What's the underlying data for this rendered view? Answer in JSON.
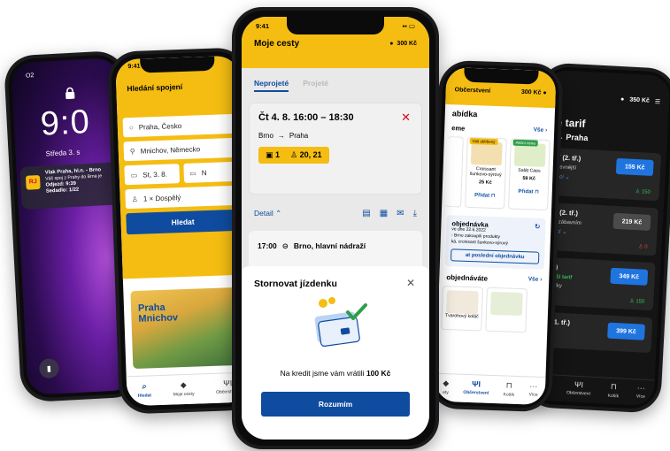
{
  "lock": {
    "carrier": "O2",
    "time": "9:0",
    "date": "Středa 3. s",
    "badge": "RJ",
    "notif_title": "Vlak Praha, hl.n. - Brno",
    "notif_line1": "Váš spoj z Prahy do Brna je",
    "notif_line2": "Odjezd: 9:39",
    "notif_line3": "Sedadlo: 1/22"
  },
  "search": {
    "time": "9:41",
    "title": "Hledání spojení",
    "from": "Praha, Česko",
    "to": "Mnichov, Německo",
    "date": "St, 3. 8.",
    "return": "N",
    "passengers": "1 × Dospělý",
    "button": "Hledat",
    "promo_line1": "Praha",
    "promo_line2": "Mnichov",
    "tabs": [
      "Hledat",
      "Moje cesty",
      "Občerstvení"
    ]
  },
  "trips": {
    "time": "9:41",
    "title": "Moje cesty",
    "credit": "300 Kč",
    "tab_active": "Neprojeté",
    "tab_inactive": "Projeté",
    "trip_when": "Čt 4. 8. 16:00 – 18:30",
    "trip_from": "Brno",
    "trip_to": "Praha",
    "car": "1",
    "seats": "20, 21",
    "detail": "Detail",
    "stop_time": "17:00",
    "stop_name": "Brno, hlavní nádraží",
    "sheet_title": "Stornovat jízdenku",
    "sheet_msg_prefix": "Na kredit jsme vám vrátili",
    "sheet_msg_amount": "100 Kč",
    "sheet_button": "Rozumím"
  },
  "refresh": {
    "title": "Občerstvení",
    "credit": "300 Kč",
    "section": "abídka",
    "subsection": "eme",
    "all": "Vše",
    "product1_tag": "Váš oblíbený",
    "product1_name": "Croissant šunkovo-sýrový",
    "product1_price": "25 Kč",
    "product2_tag": "Akční cena",
    "product2_name": "Salát Caes",
    "product2_price": "59 Kč",
    "add": "Přidat",
    "last_title": "objednávka",
    "last_line1": "ve dne 22.6.2022",
    "last_line2": "- Brno zakoupili produkty",
    "last_line3": "ká, croissant šunkovo-sýrový",
    "last_button": "at poslední objednávku",
    "ordered": "objednáváte",
    "ordered_all": "Vše",
    "product3_name": "Tvarohový koláč",
    "tabs": [
      "ety",
      "Občerstvení",
      "Košík",
      "Více"
    ]
  },
  "tariff": {
    "credit": "350 Kč",
    "title": "e tarif",
    "route": "Praha",
    "cards": [
      {
        "name": "ní (2. tř.)",
        "sub": "ejlevnější",
        "link": "nací",
        "price": "155 Kč",
        "count": "150"
      },
      {
        "name": "ní (2. tř.)",
        "sub": "se zábavním",
        "link": "nací",
        "price": "219 Kč",
        "count": "0"
      },
      {
        "name": "tř.)",
        "sub": "nější tarif",
        "link": "náčky",
        "price": "349 Kč",
        "count": "150"
      },
      {
        "name": "s (1. tř.)",
        "sub": "",
        "link": "",
        "price": "399 Kč",
        "count": ""
      }
    ],
    "tabs": [
      "cesty",
      "Občerstvení",
      "Košík",
      "Více"
    ]
  }
}
